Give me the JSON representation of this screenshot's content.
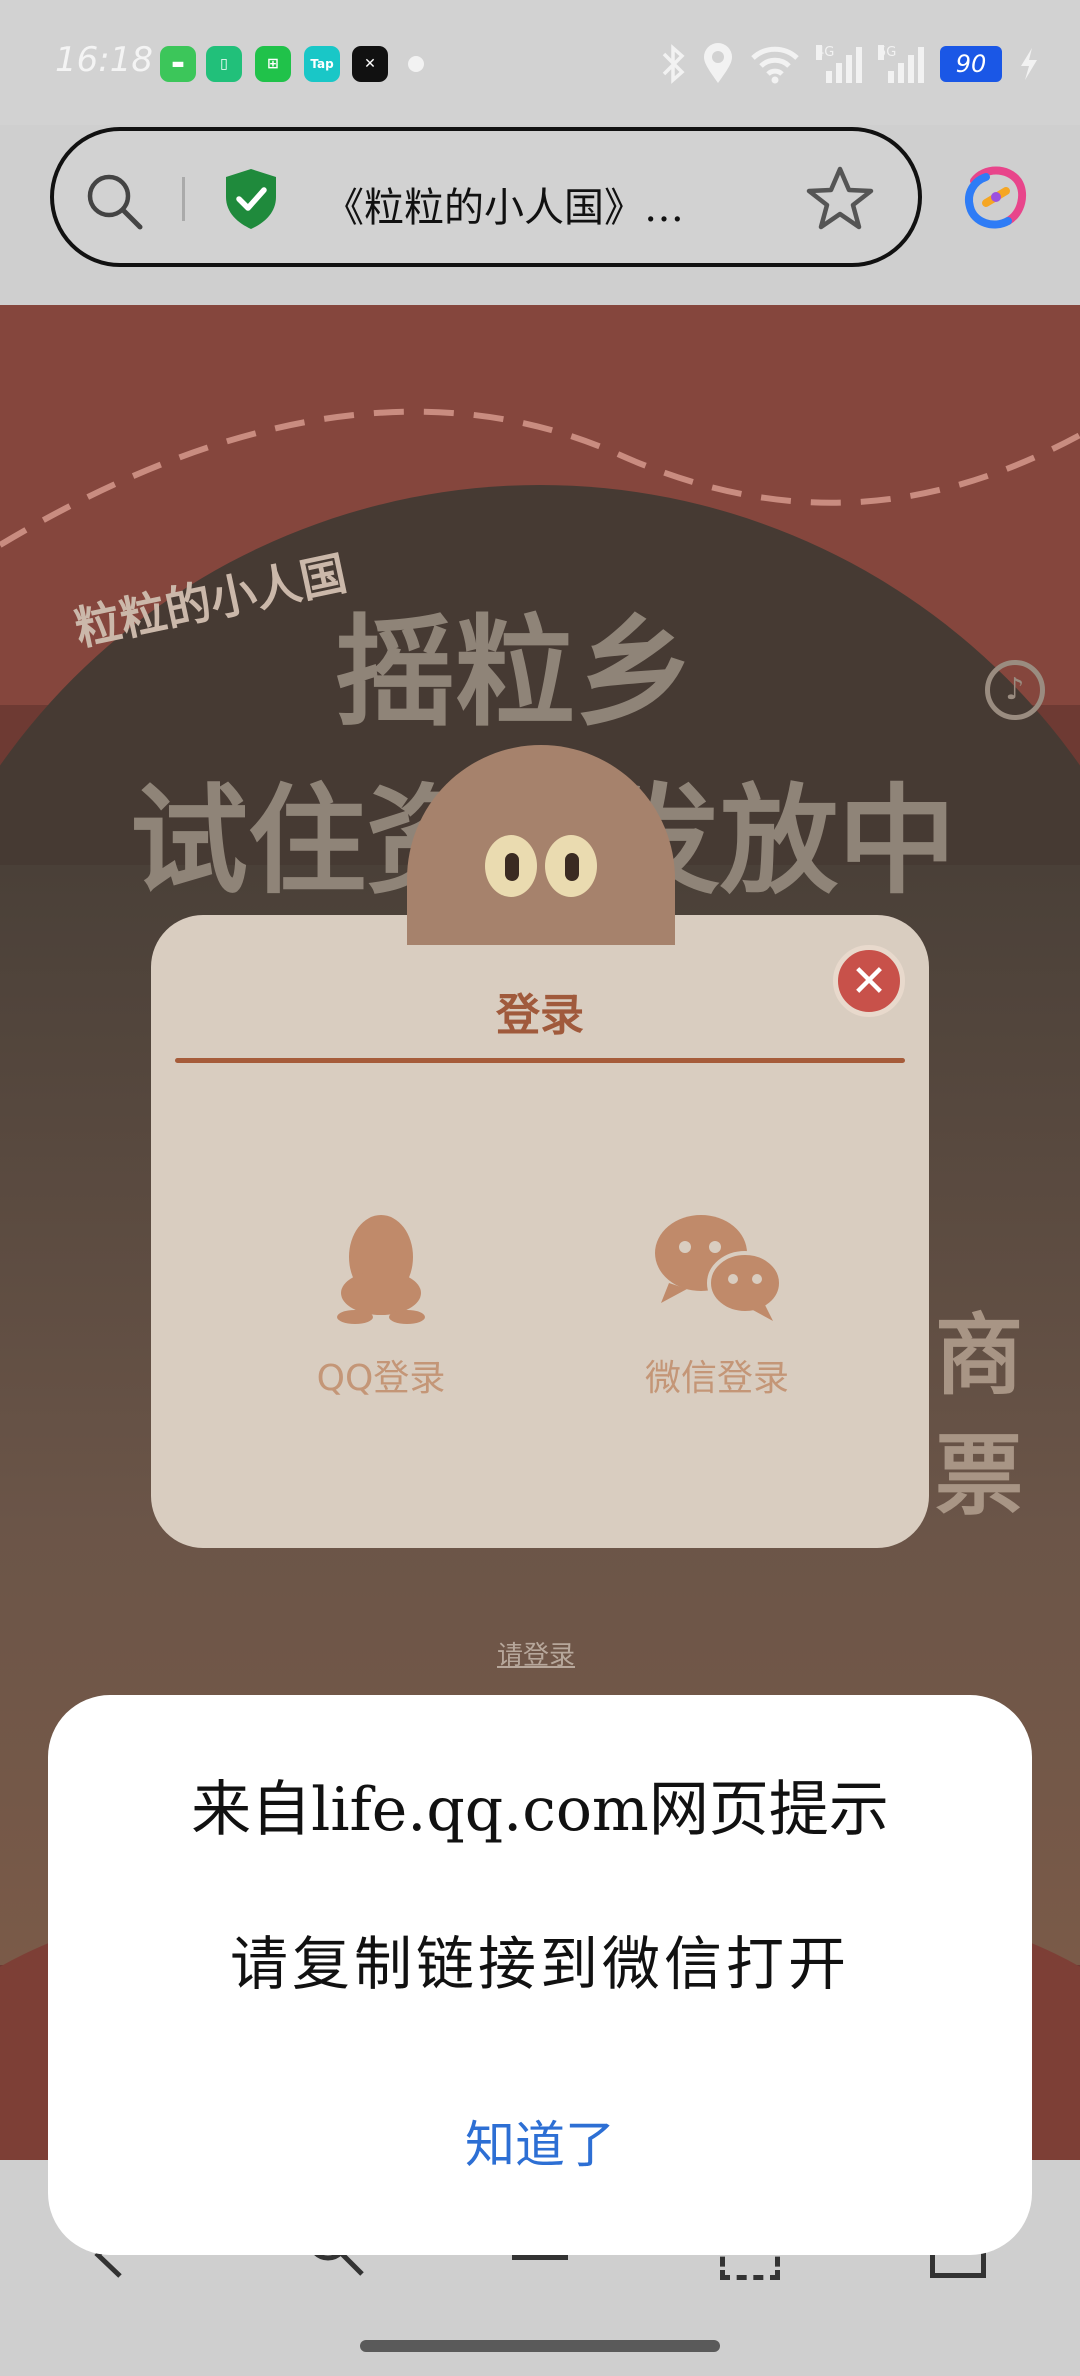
{
  "status_bar": {
    "time": "16:18",
    "network_1": "4G",
    "network_2": "5G",
    "battery": "90"
  },
  "address_bar": {
    "page_title": "《粒粒的小人国》…"
  },
  "web_page": {
    "logo": "粒粒的小人国",
    "headline_1": "摇粒乡",
    "headline_2": "试住资格发放中",
    "side_text_1": "商",
    "side_text_2": "票",
    "login_hint": "请登录"
  },
  "login_modal": {
    "title": "登录",
    "qq_label": "QQ登录",
    "wechat_label": "微信登录"
  },
  "dialog": {
    "title": "来自life.qq.com网页提示",
    "message": "请复制链接到微信打开",
    "ok_label": "知道了"
  },
  "colors": {
    "accent": "#a05a3c",
    "link_blue": "#2d6fd4",
    "close_red": "#c8514a",
    "shield_green": "#1f8a3c"
  }
}
